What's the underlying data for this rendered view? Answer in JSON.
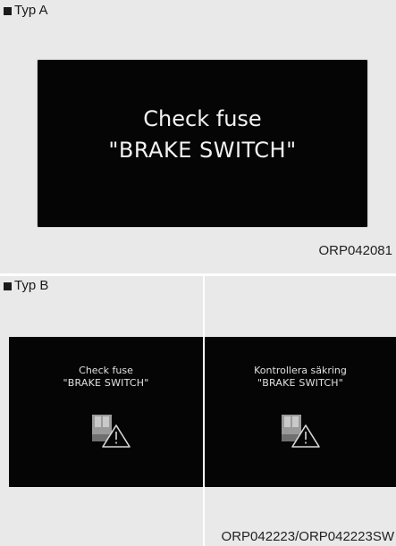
{
  "typ_a": {
    "label": "Typ A",
    "screen_line1": "Check fuse",
    "screen_line2": "\"BRAKE SWITCH\"",
    "code": "ORP042081"
  },
  "typ_b": {
    "label": "Typ B",
    "left_line1": "Check fuse",
    "left_line2": "\"BRAKE SWITCH\"",
    "right_line1": "Kontrollera säkring",
    "right_line2": "\"BRAKE SWITCH\"",
    "code": "ORP042223/ORP042223SW"
  },
  "icons": {
    "fuse": "fuse-warning-icon",
    "section_marker": "black-square"
  },
  "colors": {
    "panel_bg": "#e9e9e9",
    "screen_bg": "#050505",
    "screen_text": "#f2f2f2"
  }
}
